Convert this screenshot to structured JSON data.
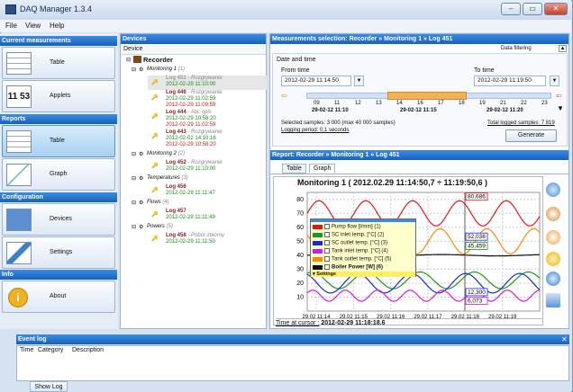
{
  "window": {
    "title": "DAQ Manager 1.3.4"
  },
  "menu": [
    "File",
    "View",
    "Help"
  ],
  "sections": {
    "current": "Current measurements",
    "reports": "Reports",
    "configuration": "Configuration",
    "info": "Info"
  },
  "nav": {
    "table": "Table",
    "applets": "Applets",
    "applets_icon_text": "11 53",
    "reports_table": "Table",
    "graph": "Graph",
    "devices": "Devices",
    "settings": "Settings",
    "about": "About"
  },
  "devices": {
    "header": "Devices",
    "column": "Device",
    "recorder": "Recorder",
    "groups": [
      {
        "name": "Monitoring 1",
        "count": "(1)"
      },
      {
        "name": "Monitoring 2",
        "count": "(2)"
      },
      {
        "name": "Temperatures",
        "count": "(3)"
      },
      {
        "name": "Flows",
        "count": "(4)"
      },
      {
        "name": "Powers",
        "count": "(5)"
      }
    ],
    "logs": [
      {
        "name": "Log 451",
        "status": " - Rozgrywanie",
        "time": "2012-02-29 11:10:00"
      },
      {
        "name": "Log 446",
        "status": " - Rozgrywanie",
        "time1": "2012-02-29 11:02:59",
        "time2": "2012-02-29 11:09:59"
      },
      {
        "name": "Log 444",
        "status": " - Abc opis",
        "time1": "2012-02-29 10:58:20",
        "time2": "2012-02-29 11:02:59"
      },
      {
        "name": "Log 443",
        "status": " - Rozgrywanie",
        "time1": "2012-02-02 14:10:16",
        "time2": "2012-02-29 10:58:20"
      },
      {
        "name": "Log 452",
        "status": " - Rozgrywanie",
        "time": "2012-02-29 11:10:00"
      },
      {
        "name": "Log 456",
        "time": "2012-02-29 11:11:47"
      },
      {
        "name": "Log 457",
        "time": "2012-02-29 11:11:49"
      },
      {
        "name": "Log 458",
        "status": " - Pobór zbiorny",
        "time": "2012-02-29 11:11:50"
      }
    ]
  },
  "selection": {
    "header": "Measurements selection:  Recorder » Monitoring 1 » Log 451",
    "filtering": "Data filtering",
    "date_time": "Date and time",
    "from_label": "From time",
    "from_value": "2012-02-29 11:14:50",
    "to_label": "To time",
    "to_value": "2012-02-29 11:19:50",
    "ticks": [
      "09",
      "11",
      "12",
      "13",
      "14",
      "16",
      "17",
      "18",
      "19",
      "21",
      "22",
      "23"
    ],
    "tl1": "29-02-12 11:10",
    "tl2": "29-02-12 11:15",
    "tl3": "29-02-12 11:20",
    "selected": "Selected samples: 3 000 (max 40 000 samples)",
    "period": "Logging period: 0,1 seconds",
    "total": "Total logged samples: 7 819",
    "generate": "Generate"
  },
  "report": {
    "header": "Report:  Recorder » Monitoring 1 » Log 451",
    "tab_table": "Table",
    "tab_graph": "Graph",
    "cursor_label": "Time at cursor :",
    "cursor_value": "2012-02-29 11:18:18.6"
  },
  "chart_data": {
    "type": "line",
    "title": "Monitoring 1 ( 2012.02.29 11:14:50,7 ÷ 11:19:50,6 )",
    "ylim": [
      0,
      85
    ],
    "yticks": [
      "80",
      "70",
      "60",
      "50",
      "40",
      "30",
      "20",
      "10"
    ],
    "xticks": [
      "29.02 11:14",
      "29.02 11:15",
      "29.02 11:16",
      "29.02 11:17",
      "29.02 11:18",
      "29.02 11:19"
    ],
    "series": [
      {
        "name": "Pump flow [l/min] (1)",
        "color": "#e01818"
      },
      {
        "name": "SC inlet temp. [°C] (2)",
        "color": "#1a9a1a"
      },
      {
        "name": "SC outlet temp. [°C] (3)",
        "color": "#1a2ad0"
      },
      {
        "name": "Tank inlet temp. [°C] (4)",
        "color": "#d81ad8"
      },
      {
        "name": "Tank outlet temp. [°C] (5)",
        "color": "#ff8a00"
      },
      {
        "name": "Boiler Power [W] (6)",
        "color": "#111111"
      }
    ],
    "settings_label": "Settings",
    "cursor_labels": [
      "80,686",
      "52,038",
      "45,459",
      "12,300",
      "6,073"
    ]
  },
  "eventlog": {
    "header": "Event log",
    "columns": [
      "Time",
      "Category",
      "Description"
    ],
    "show": "Show Log"
  }
}
